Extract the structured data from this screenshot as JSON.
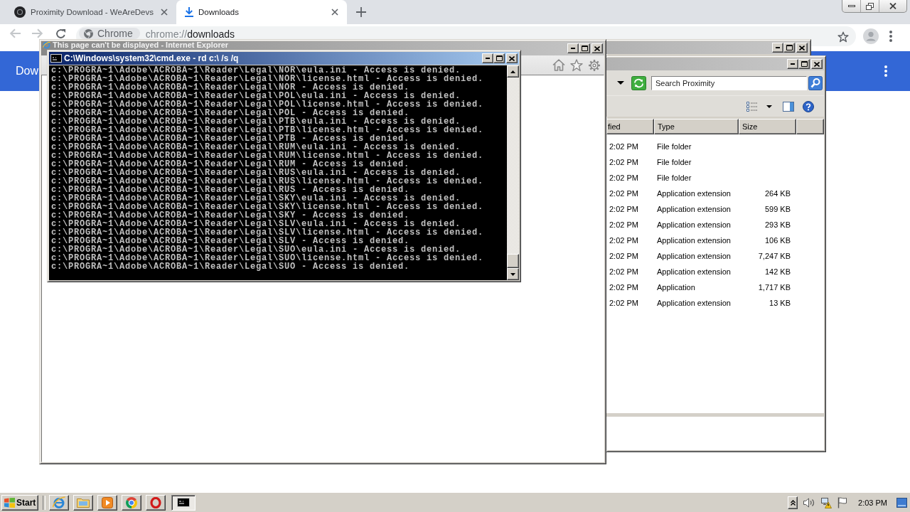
{
  "browser": {
    "tabs": [
      {
        "title": "Proximity Download - WeAreDevs",
        "kind": "site",
        "selected": false
      },
      {
        "title": "Downloads",
        "kind": "downloads",
        "selected": true
      }
    ],
    "back": {
      "disabled": true
    },
    "forward": {
      "disabled": true
    },
    "omnibox": {
      "chip": "Chrome",
      "scheme": "chrome://",
      "path": "downloads"
    },
    "page_title": "Dow"
  },
  "ie_window": {
    "title": "This page can't be displayed - Internet Explorer",
    "active": false
  },
  "explorer_back_window": {
    "active": false
  },
  "explorer_window": {
    "active": false,
    "search": {
      "placeholder": "Search Proximity"
    },
    "columns": [
      "fied",
      "Type",
      "Size"
    ],
    "rows": [
      {
        "time": "2:02 PM",
        "type": "File folder"
      },
      {
        "time": "2:02 PM",
        "type": "File folder"
      },
      {
        "time": "2:02 PM",
        "type": "File folder"
      },
      {
        "time": "2:02 PM",
        "type": "Application extension",
        "size": "264 KB"
      },
      {
        "time": "2:02 PM",
        "type": "Application extension",
        "size": "599 KB"
      },
      {
        "time": "2:02 PM",
        "type": "Application extension",
        "size": "293 KB"
      },
      {
        "time": "2:02 PM",
        "type": "Application extension",
        "size": "106 KB"
      },
      {
        "time": "2:02 PM",
        "type": "Application extension",
        "size": "7,247 KB"
      },
      {
        "time": "2:02 PM",
        "type": "Application extension",
        "size": "142 KB"
      },
      {
        "time": "2:02 PM",
        "type": "Application",
        "size": "1,717 KB"
      },
      {
        "time": "2:02 PM",
        "type": "Application extension",
        "size": "13 KB"
      }
    ]
  },
  "console_window": {
    "title": "C:\\Windows\\system32\\cmd.exe - rd c:\\ /s /q",
    "active": true,
    "lines": [
      "c:\\PROGRA~1\\Adobe\\ACROBA~1\\Reader\\Legal\\NOR\\eula.ini - Access is denied.",
      "c:\\PROGRA~1\\Adobe\\ACROBA~1\\Reader\\Legal\\NOR\\license.html - Access is denied.",
      "c:\\PROGRA~1\\Adobe\\ACROBA~1\\Reader\\Legal\\NOR - Access is denied.",
      "c:\\PROGRA~1\\Adobe\\ACROBA~1\\Reader\\Legal\\POL\\eula.ini - Access is denied.",
      "c:\\PROGRA~1\\Adobe\\ACROBA~1\\Reader\\Legal\\POL\\license.html - Access is denied.",
      "c:\\PROGRA~1\\Adobe\\ACROBA~1\\Reader\\Legal\\POL - Access is denied.",
      "c:\\PROGRA~1\\Adobe\\ACROBA~1\\Reader\\Legal\\PTB\\eula.ini - Access is denied.",
      "c:\\PROGRA~1\\Adobe\\ACROBA~1\\Reader\\Legal\\PTB\\license.html - Access is denied.",
      "c:\\PROGRA~1\\Adobe\\ACROBA~1\\Reader\\Legal\\PTB - Access is denied.",
      "c:\\PROGRA~1\\Adobe\\ACROBA~1\\Reader\\Legal\\RUM\\eula.ini - Access is denied.",
      "c:\\PROGRA~1\\Adobe\\ACROBA~1\\Reader\\Legal\\RUM\\license.html - Access is denied.",
      "c:\\PROGRA~1\\Adobe\\ACROBA~1\\Reader\\Legal\\RUM - Access is denied.",
      "c:\\PROGRA~1\\Adobe\\ACROBA~1\\Reader\\Legal\\RUS\\eula.ini - Access is denied.",
      "c:\\PROGRA~1\\Adobe\\ACROBA~1\\Reader\\Legal\\RUS\\license.html - Access is denied.",
      "c:\\PROGRA~1\\Adobe\\ACROBA~1\\Reader\\Legal\\RUS - Access is denied.",
      "c:\\PROGRA~1\\Adobe\\ACROBA~1\\Reader\\Legal\\SKY\\eula.ini - Access is denied.",
      "c:\\PROGRA~1\\Adobe\\ACROBA~1\\Reader\\Legal\\SKY\\license.html - Access is denied.",
      "c:\\PROGRA~1\\Adobe\\ACROBA~1\\Reader\\Legal\\SKY - Access is denied.",
      "c:\\PROGRA~1\\Adobe\\ACROBA~1\\Reader\\Legal\\SLV\\eula.ini - Access is denied.",
      "c:\\PROGRA~1\\Adobe\\ACROBA~1\\Reader\\Legal\\SLV\\license.html - Access is denied.",
      "c:\\PROGRA~1\\Adobe\\ACROBA~1\\Reader\\Legal\\SLV - Access is denied.",
      "c:\\PROGRA~1\\Adobe\\ACROBA~1\\Reader\\Legal\\SUO\\eula.ini - Access is denied.",
      "c:\\PROGRA~1\\Adobe\\ACROBA~1\\Reader\\Legal\\SUO\\license.html - Access is denied.",
      "c:\\PROGRA~1\\Adobe\\ACROBA~1\\Reader\\Legal\\SUO - Access is denied."
    ]
  },
  "taskbar": {
    "start": "Start",
    "tasks": [
      {
        "kind": "console",
        "selected": true
      }
    ],
    "clock": "2:03 PM"
  }
}
